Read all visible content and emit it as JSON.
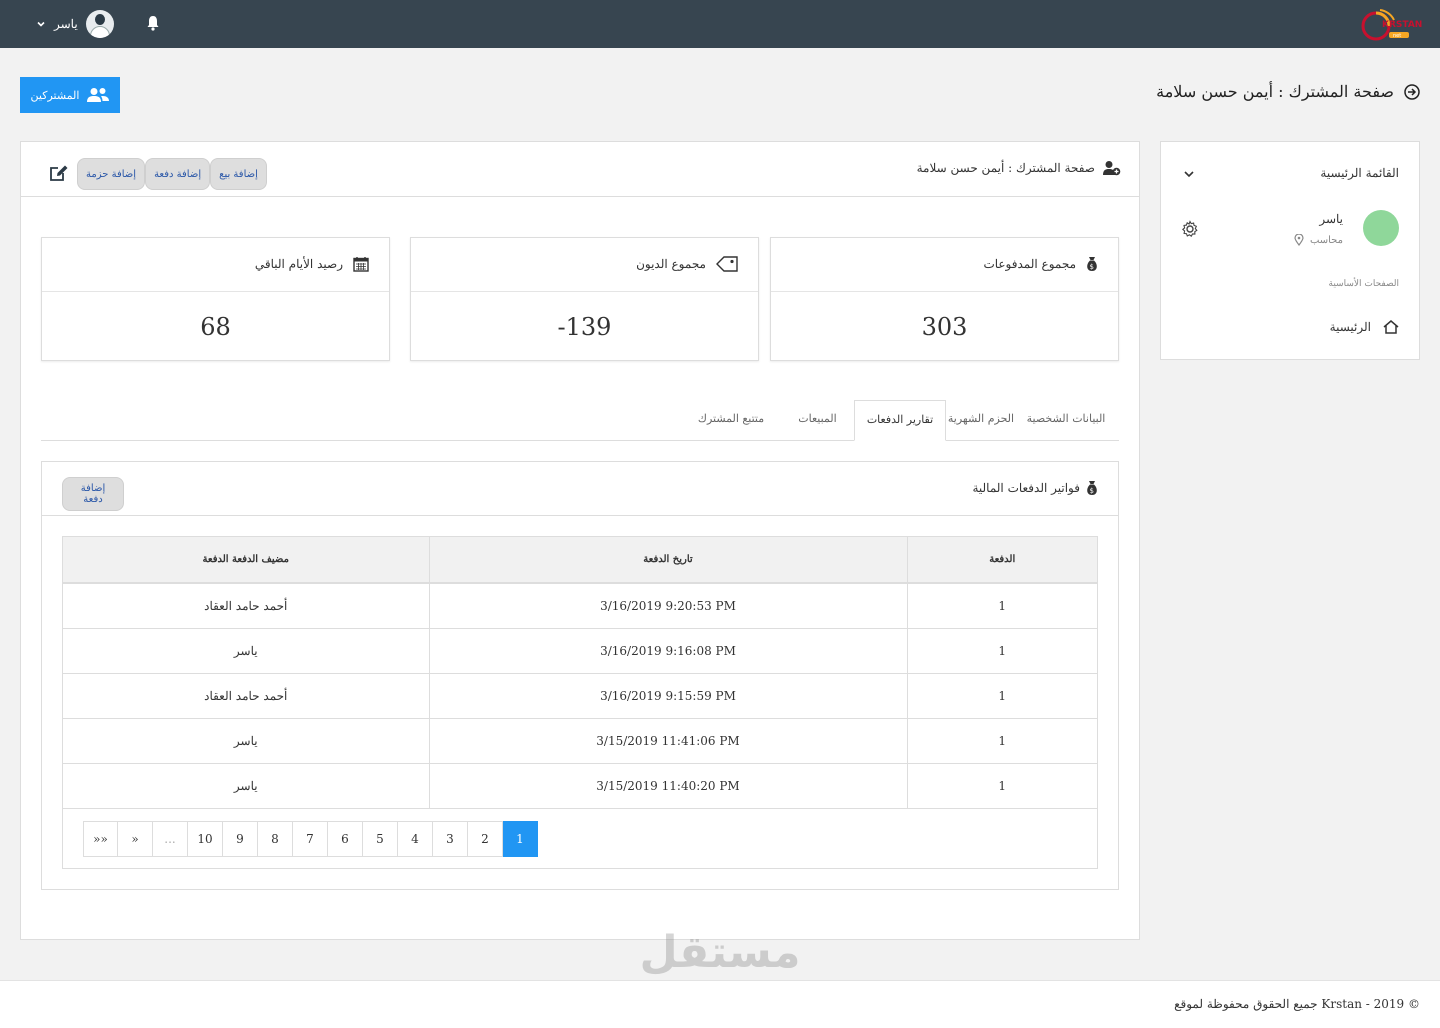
{
  "topbar": {
    "user_name": "ياسر",
    "logo_text": "KRSTAN",
    "logo_sub": "net"
  },
  "page": {
    "title": "صفحة المشترك : أيمن حسن سلامة",
    "subscribers_button": "المشتركين"
  },
  "sidebar": {
    "title": "القائمة الرئيسية",
    "user_name": "ياسر",
    "user_role": "محاسب",
    "avatar_color": "#8fd79a",
    "section_label": "الصفحات الأساسية",
    "home_label": "الرئيسية"
  },
  "main": {
    "header_title": "صفحة المشترك : أيمن حسن سلامة",
    "buttons": {
      "add_sale": "إضافة بيع",
      "add_payment": "إضافة دفعة",
      "add_package": "إضافة حزمة"
    }
  },
  "cards": {
    "payments": {
      "label": "مجموع المدفوعات",
      "value": "303"
    },
    "debts": {
      "label": "مجموع الديون",
      "value": "-139"
    },
    "days": {
      "label": "رصيد الأيام الباقي",
      "value": "68"
    }
  },
  "tabs": [
    "البيانات الشخصية",
    "الحزم الشهرية",
    "تقارير الدفعات",
    "المبيعات",
    "متتبع المشترك"
  ],
  "active_tab": "تقارير الدفعات",
  "panel": {
    "title": "فواتير الدفعات المالية",
    "add_payment": "إضافة دفعة",
    "columns": [
      "الدفعة",
      "تاريخ الدفعة",
      "مضيف الدفعة الدفعة"
    ],
    "rows": [
      {
        "payment": "1",
        "date": "3/16/2019 9:20:53 PM",
        "added_by": "أحمد حامد العقاد"
      },
      {
        "payment": "1",
        "date": "3/16/2019 9:16:08 PM",
        "added_by": "ياسر"
      },
      {
        "payment": "1",
        "date": "3/16/2019 9:15:59 PM",
        "added_by": "أحمد حامد العقاد"
      },
      {
        "payment": "1",
        "date": "3/15/2019 11:41:06 PM",
        "added_by": "ياسر"
      },
      {
        "payment": "1",
        "date": "3/15/2019 11:40:20 PM",
        "added_by": "ياسر"
      }
    ]
  },
  "pagination": {
    "pages": [
      "1",
      "2",
      "3",
      "4",
      "5",
      "6",
      "7",
      "8",
      "9",
      "10"
    ],
    "ellipsis": "...",
    "next": "»",
    "last": "»»",
    "active": "1"
  },
  "footer": {
    "text": "جميع الحقوق محفوظة لموقع Krstan - 2019 ©"
  },
  "watermark": {
    "arabic": "مستقل",
    "latin": "mostaql.com"
  },
  "colors": {
    "topbar": "#374550",
    "primary": "#2196f3",
    "brand": "#c8102e"
  }
}
